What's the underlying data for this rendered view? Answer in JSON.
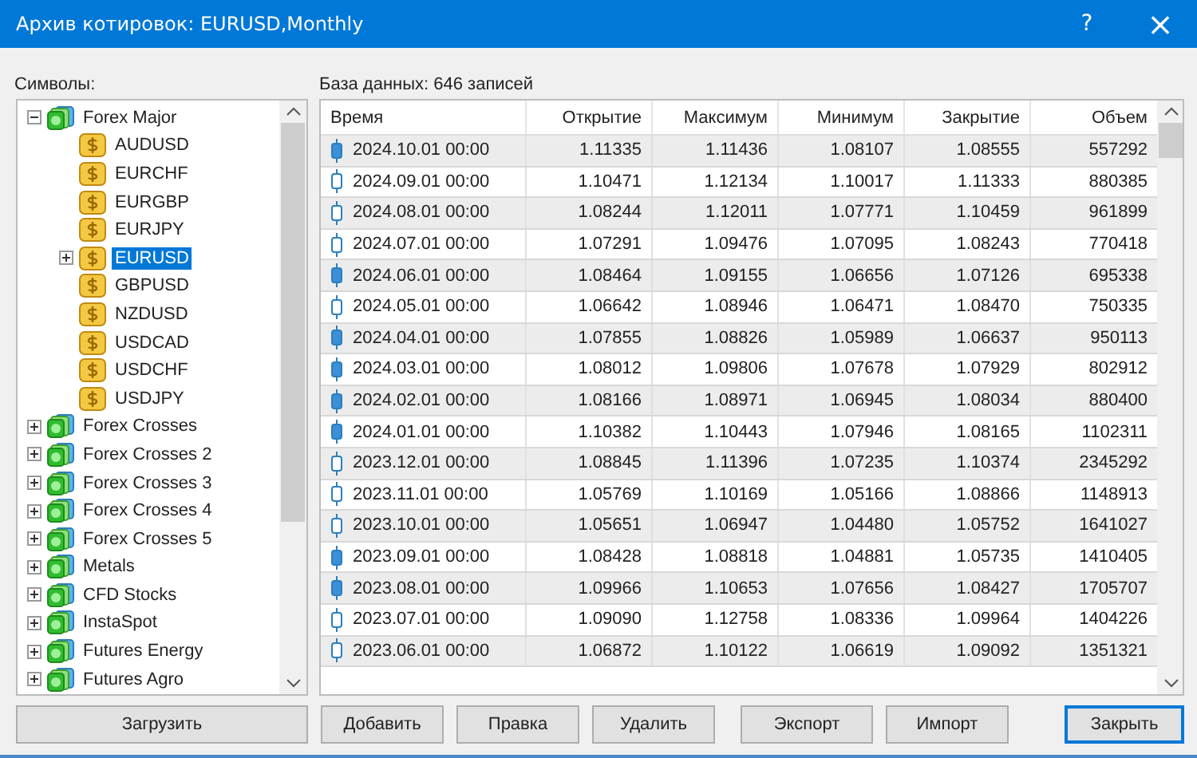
{
  "window": {
    "title": "Архив котировок: EURUSD,Monthly",
    "help": "?",
    "close": "×"
  },
  "symbols_label": "Символы:",
  "tree": [
    {
      "label": "Forex Major",
      "kind": "group",
      "expanded": true,
      "selected": false,
      "children": [
        {
          "label": "AUDUSD",
          "kind": "symbol",
          "selected": false
        },
        {
          "label": "EURCHF",
          "kind": "symbol",
          "selected": false
        },
        {
          "label": "EURGBP",
          "kind": "symbol",
          "selected": false
        },
        {
          "label": "EURJPY",
          "kind": "symbol",
          "selected": false
        },
        {
          "label": "EURUSD",
          "kind": "symbol",
          "selected": true,
          "expanded": false
        },
        {
          "label": "GBPUSD",
          "kind": "symbol",
          "selected": false
        },
        {
          "label": "NZDUSD",
          "kind": "symbol",
          "selected": false
        },
        {
          "label": "USDCAD",
          "kind": "symbol",
          "selected": false
        },
        {
          "label": "USDCHF",
          "kind": "symbol",
          "selected": false
        },
        {
          "label": "USDJPY",
          "kind": "symbol",
          "selected": false
        }
      ]
    },
    {
      "label": "Forex Crosses",
      "kind": "group",
      "expanded": false,
      "selected": false
    },
    {
      "label": "Forex Crosses 2",
      "kind": "group",
      "expanded": false,
      "selected": false
    },
    {
      "label": "Forex Crosses 3",
      "kind": "group",
      "expanded": false,
      "selected": false
    },
    {
      "label": "Forex Crosses 4",
      "kind": "group",
      "expanded": false,
      "selected": false
    },
    {
      "label": "Forex Crosses 5",
      "kind": "group",
      "expanded": false,
      "selected": false
    },
    {
      "label": "Metals",
      "kind": "group",
      "expanded": false,
      "selected": false
    },
    {
      "label": "CFD Stocks",
      "kind": "group",
      "expanded": false,
      "selected": false
    },
    {
      "label": "InstaSpot",
      "kind": "group",
      "expanded": false,
      "selected": false
    },
    {
      "label": "Futures Energy",
      "kind": "group",
      "expanded": false,
      "selected": false
    },
    {
      "label": "Futures Agro",
      "kind": "group",
      "expanded": false,
      "selected": false
    }
  ],
  "database_label": "База данных: 646 записей",
  "table": {
    "columns": [
      "Время",
      "Открытие",
      "Максимум",
      "Минимум",
      "Закрытие",
      "Объем"
    ],
    "rows": [
      {
        "bearish": true,
        "cells": [
          "2024.10.01 00:00",
          "1.11335",
          "1.11436",
          "1.08107",
          "1.08555",
          "557292"
        ]
      },
      {
        "bearish": false,
        "cells": [
          "2024.09.01 00:00",
          "1.10471",
          "1.12134",
          "1.10017",
          "1.11333",
          "880385"
        ]
      },
      {
        "bearish": false,
        "cells": [
          "2024.08.01 00:00",
          "1.08244",
          "1.12011",
          "1.07771",
          "1.10459",
          "961899"
        ]
      },
      {
        "bearish": false,
        "cells": [
          "2024.07.01 00:00",
          "1.07291",
          "1.09476",
          "1.07095",
          "1.08243",
          "770418"
        ]
      },
      {
        "bearish": true,
        "cells": [
          "2024.06.01 00:00",
          "1.08464",
          "1.09155",
          "1.06656",
          "1.07126",
          "695338"
        ]
      },
      {
        "bearish": false,
        "cells": [
          "2024.05.01 00:00",
          "1.06642",
          "1.08946",
          "1.06471",
          "1.08470",
          "750335"
        ]
      },
      {
        "bearish": true,
        "cells": [
          "2024.04.01 00:00",
          "1.07855",
          "1.08826",
          "1.05989",
          "1.06637",
          "950113"
        ]
      },
      {
        "bearish": true,
        "cells": [
          "2024.03.01 00:00",
          "1.08012",
          "1.09806",
          "1.07678",
          "1.07929",
          "802912"
        ]
      },
      {
        "bearish": true,
        "cells": [
          "2024.02.01 00:00",
          "1.08166",
          "1.08971",
          "1.06945",
          "1.08034",
          "880400"
        ]
      },
      {
        "bearish": true,
        "cells": [
          "2024.01.01 00:00",
          "1.10382",
          "1.10443",
          "1.07946",
          "1.08165",
          "1102311"
        ]
      },
      {
        "bearish": false,
        "cells": [
          "2023.12.01 00:00",
          "1.08845",
          "1.11396",
          "1.07235",
          "1.10374",
          "2345292"
        ]
      },
      {
        "bearish": false,
        "cells": [
          "2023.11.01 00:00",
          "1.05769",
          "1.10169",
          "1.05166",
          "1.08866",
          "1148913"
        ]
      },
      {
        "bearish": false,
        "cells": [
          "2023.10.01 00:00",
          "1.05651",
          "1.06947",
          "1.04480",
          "1.05752",
          "1641027"
        ]
      },
      {
        "bearish": true,
        "cells": [
          "2023.09.01 00:00",
          "1.08428",
          "1.08818",
          "1.04881",
          "1.05735",
          "1410405"
        ]
      },
      {
        "bearish": true,
        "cells": [
          "2023.08.01 00:00",
          "1.09966",
          "1.10653",
          "1.07656",
          "1.08427",
          "1705707"
        ]
      },
      {
        "bearish": false,
        "cells": [
          "2023.07.01 00:00",
          "1.09090",
          "1.12758",
          "1.08336",
          "1.09964",
          "1404226"
        ]
      },
      {
        "bearish": false,
        "cells": [
          "2023.06.01 00:00",
          "1.06872",
          "1.10122",
          "1.06619",
          "1.09092",
          "1351321"
        ]
      }
    ]
  },
  "buttons": [
    {
      "label": "Загрузить",
      "kind": "wide",
      "focused": false
    },
    {
      "label": "Добавить",
      "kind": "normal",
      "focused": false
    },
    {
      "label": "Правка",
      "kind": "normal",
      "focused": false
    },
    {
      "label": "Удалить",
      "kind": "normal",
      "focused": false
    },
    {
      "label": "Экспорт",
      "kind": "spaced",
      "focused": false
    },
    {
      "label": "Импорт",
      "kind": "normal",
      "focused": false
    },
    {
      "label": "Закрыть",
      "kind": "spaced",
      "focused": true
    }
  ]
}
